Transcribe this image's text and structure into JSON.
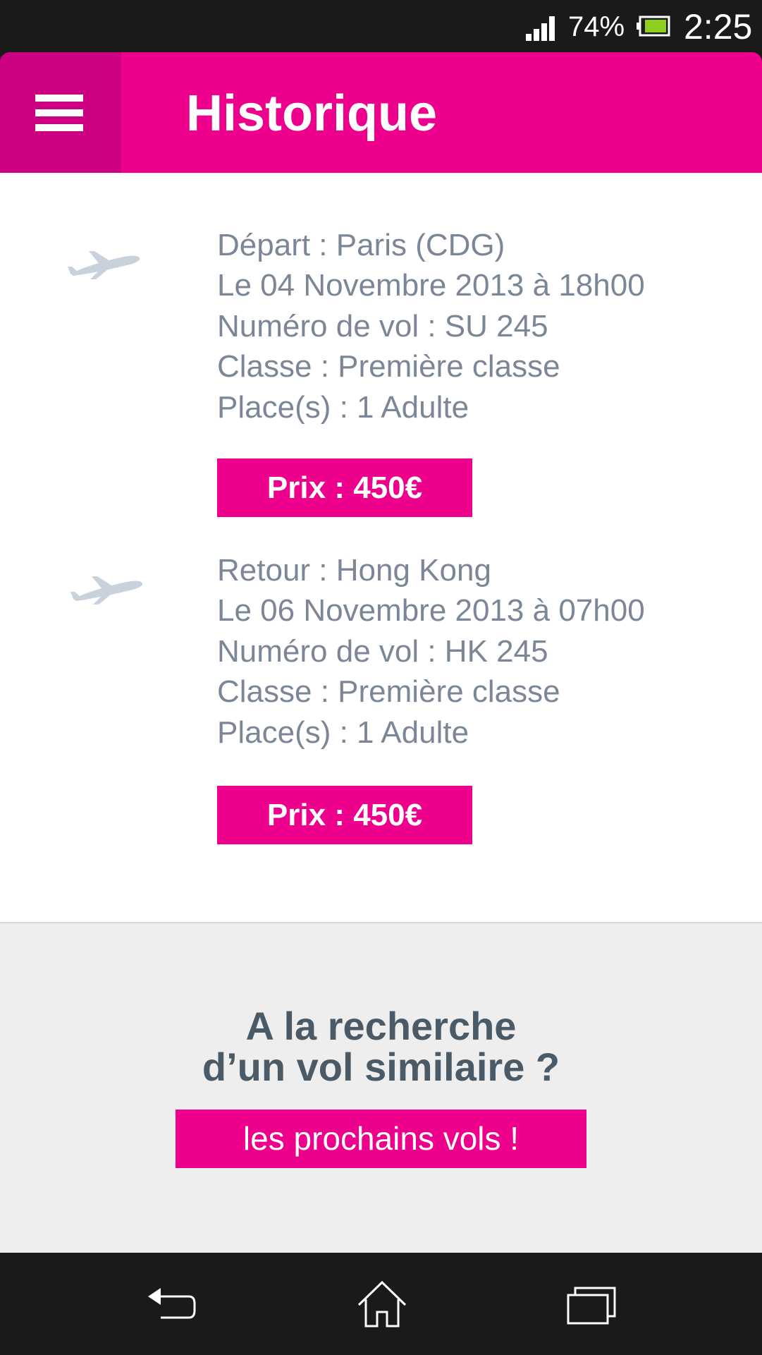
{
  "status_bar": {
    "battery_percent": "74%",
    "time": "2:25",
    "icons": [
      "signal-icon",
      "battery-icon"
    ]
  },
  "app_bar": {
    "title": "Historique",
    "menu_icon": "hamburger-menu-icon"
  },
  "flights": [
    {
      "icon": "airplane-icon",
      "lines": [
        "Départ : Paris (CDG)",
        "Le 04 Novembre 2013 à 18h00",
        "Numéro de vol : SU 245",
        "Classe : Première classe",
        "Place(s) : 1 Adulte"
      ],
      "price_label": "Prix : 450€"
    },
    {
      "icon": "airplane-icon",
      "lines": [
        "Retour : Hong Kong",
        "Le 06 Novembre 2013 à 07h00",
        "Numéro de vol : HK 245",
        "Classe : Première classe",
        "Place(s) : 1 Adulte"
      ],
      "price_label": "Prix : 450€"
    }
  ],
  "cta": {
    "title_line1": "A la recherche",
    "title_line2": "d’un vol similaire ?",
    "button_label": "les prochains vols !"
  },
  "nav_bar": {
    "icons": [
      "back-icon",
      "home-icon",
      "recent-apps-icon"
    ]
  },
  "colors": {
    "accent": "#ec008c",
    "accent_dark": "#cc0080",
    "text_grey": "#7b8796",
    "cta_title": "#4a5a66",
    "cta_background": "#eeeeee"
  }
}
